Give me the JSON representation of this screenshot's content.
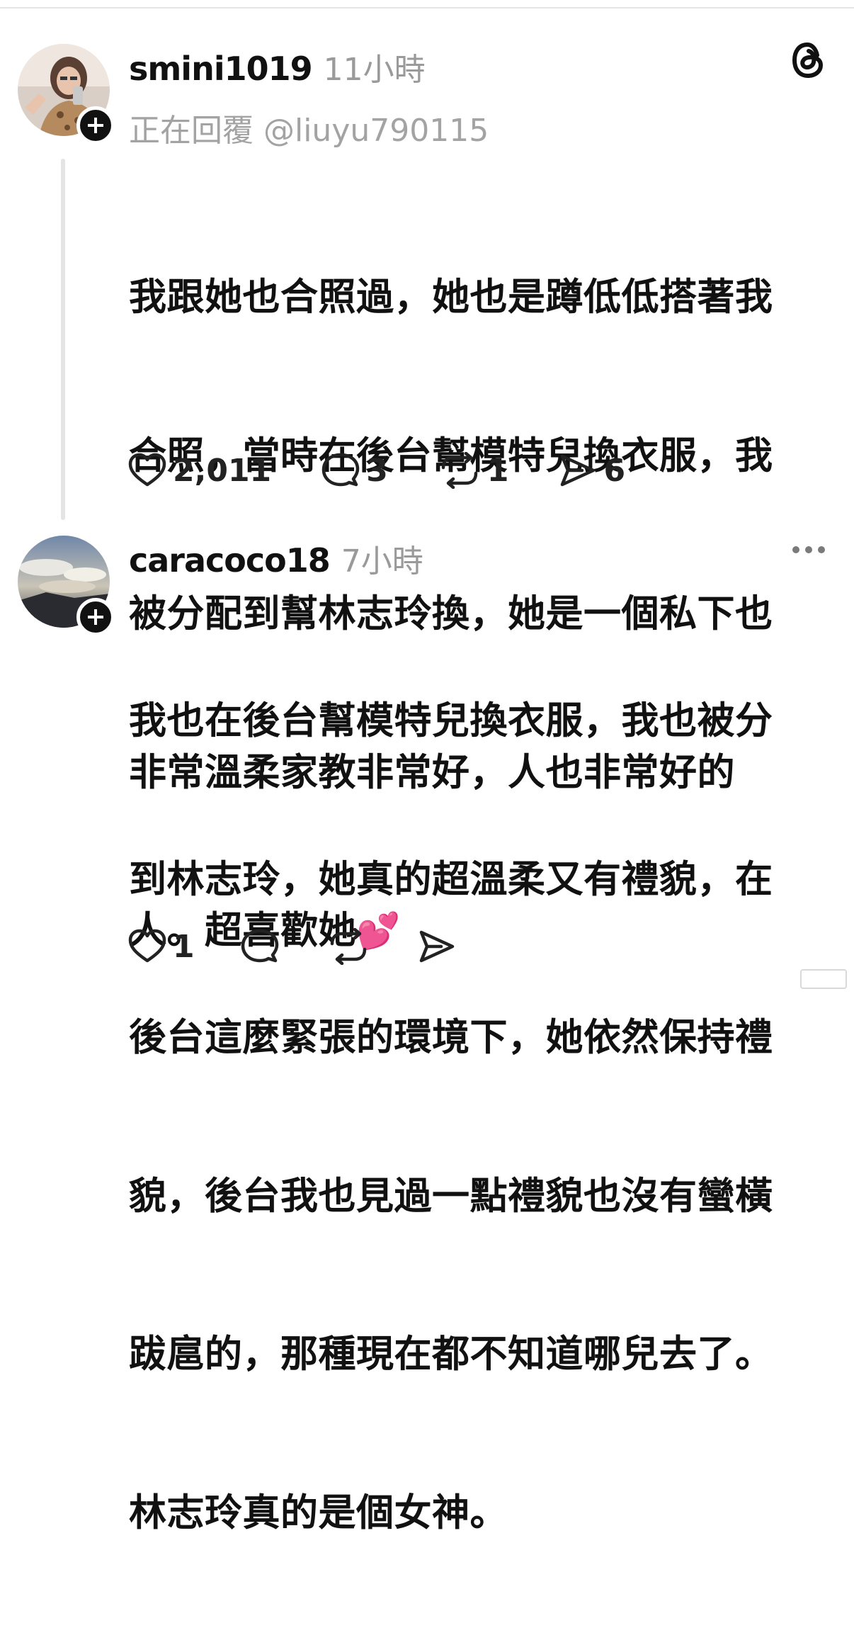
{
  "posts": [
    {
      "username": "smini1019",
      "time": "11小時",
      "reply_to": "正在回覆 @liuyu790115",
      "body_lines": [
        "我跟她也合照過，她也是蹲低低搭著我",
        "合照，當時在後台幫模特兒換衣服，我",
        "被分配到幫林志玲換，她是一個私下也",
        "非常溫柔家教非常好，人也非常好的",
        "人。超喜歡她"
      ],
      "emoji": "💕",
      "likes": "2,011",
      "comments": "3",
      "reposts": "1",
      "shares": "6"
    },
    {
      "username": "caracoco18",
      "time": "7小時",
      "body_lines": [
        "我也在後台幫模特兒換衣服，我也被分",
        "到林志玲，她真的超溫柔又有禮貌，在",
        "後台這麼緊張的環境下，她依然保持禮",
        "貌，後台我也見過一點禮貌也沒有蠻橫",
        "跋扈的，那種現在都不知道哪兒去了。",
        "林志玲真的是個女神。"
      ],
      "likes": "1"
    }
  ],
  "icons": {
    "header_right_1": "threads-logo-icon",
    "header_right_2": "more-options-icon"
  }
}
